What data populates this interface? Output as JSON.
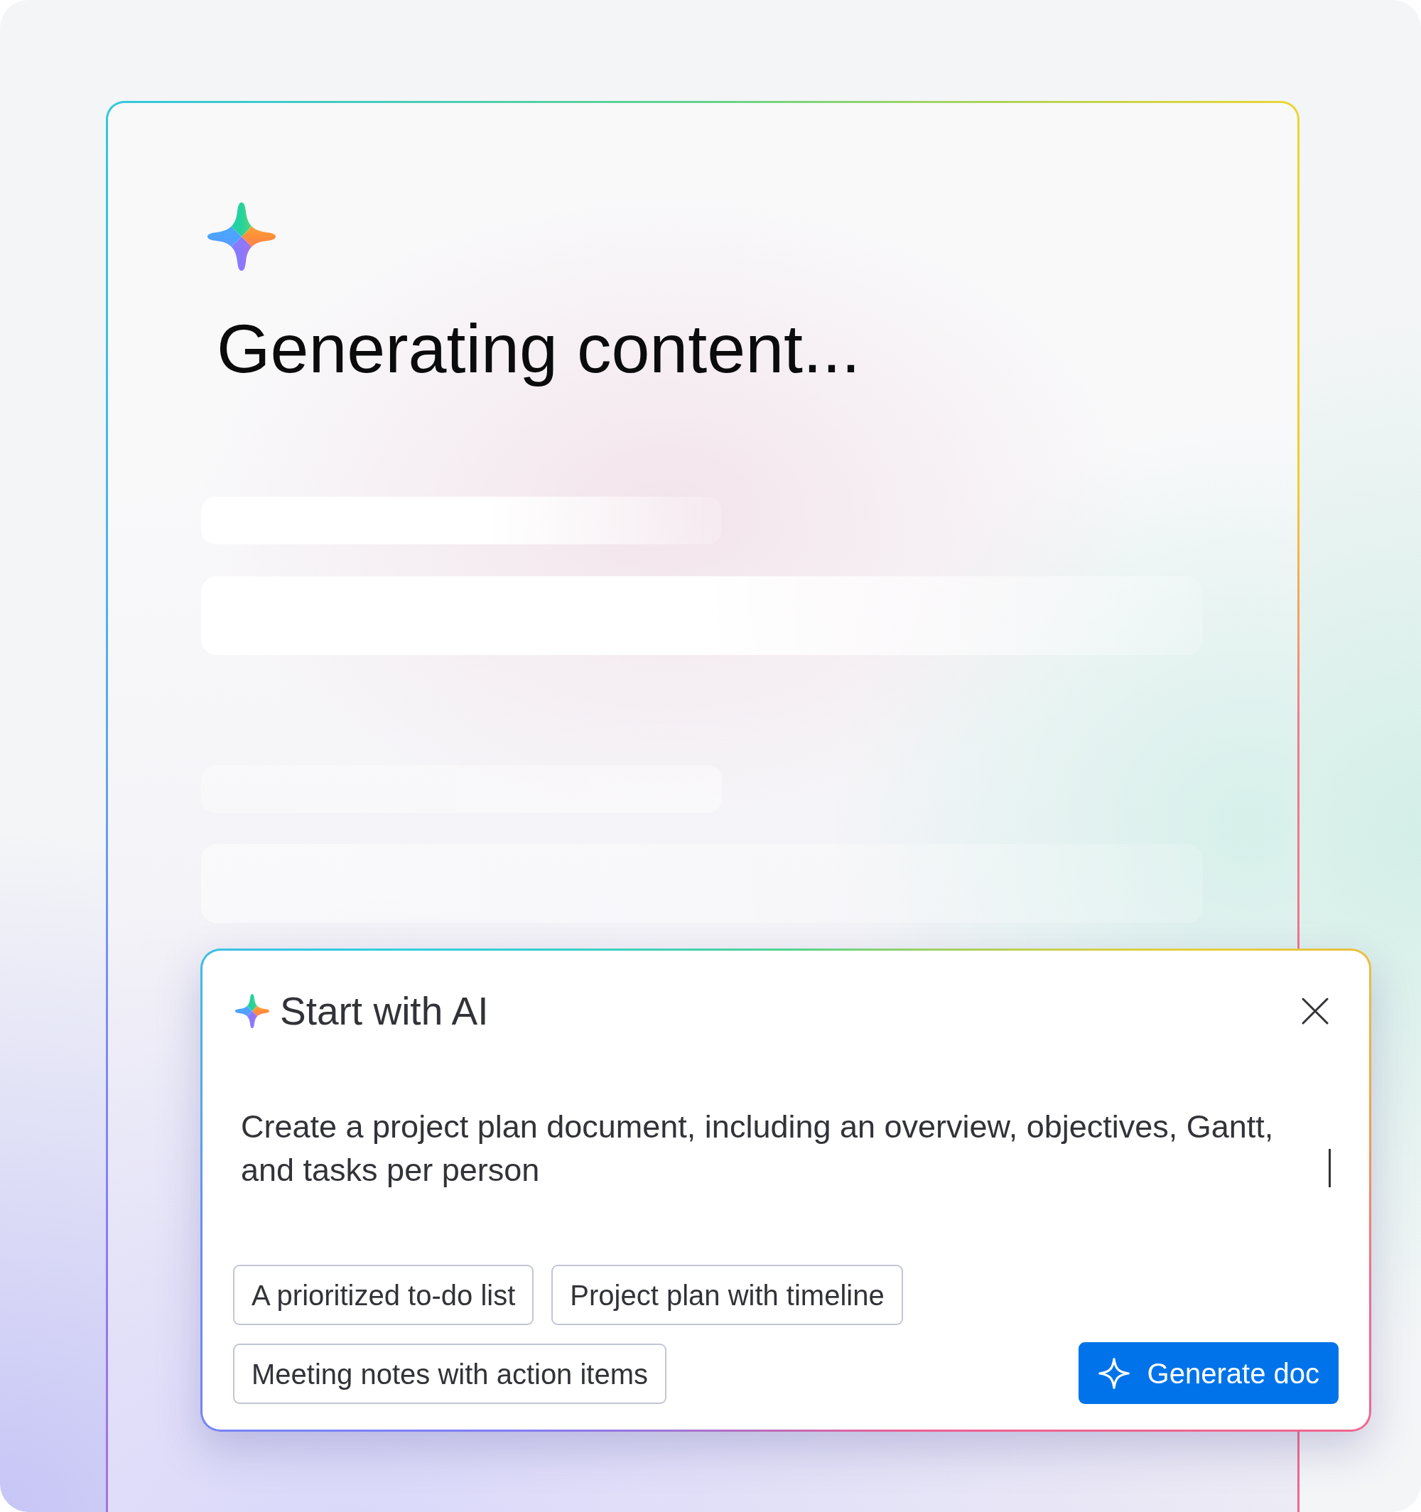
{
  "page": {
    "heading": "Generating content..."
  },
  "dialog": {
    "title": "Start with AI",
    "prompt": {
      "value": "Create a project plan document, including an overview, objectives, Gantt, and tasks per person",
      "focused": true
    },
    "suggestions": [
      {
        "label": "A prioritized to-do list"
      },
      {
        "label": "Project plan with timeline"
      },
      {
        "label": "Meeting notes with action items"
      }
    ],
    "primary_button": {
      "label": "Generate doc"
    }
  }
}
